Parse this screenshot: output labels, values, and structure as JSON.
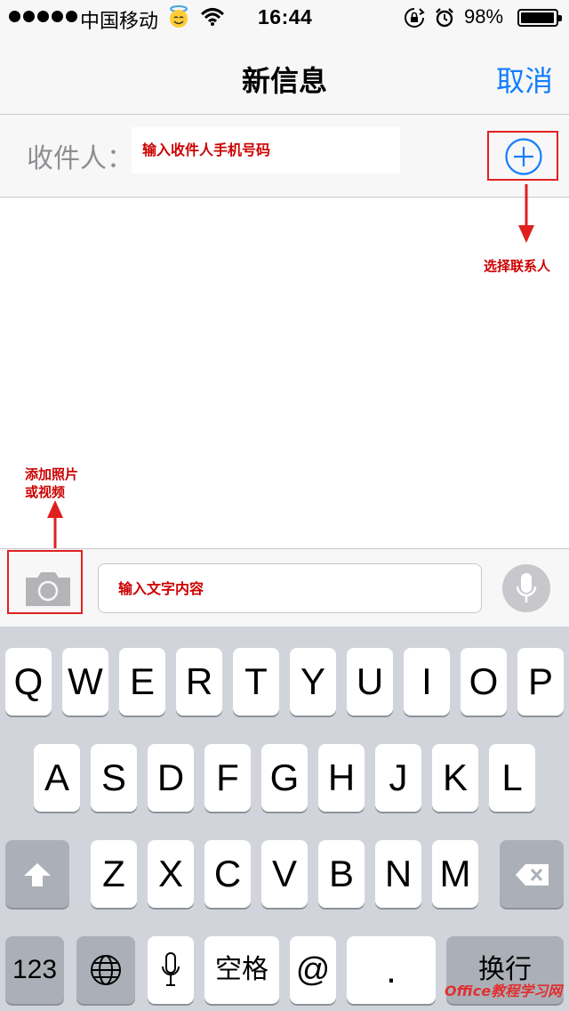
{
  "status_bar": {
    "carrier": "中国移动",
    "time": "16:44",
    "battery": "98%"
  },
  "nav": {
    "title": "新信息",
    "cancel": "取消"
  },
  "recipient": {
    "label": "收件人：",
    "placeholder": "输入收件人手机号码"
  },
  "annotations": {
    "contact": "选择联系人",
    "photo_line1": "添加照片",
    "photo_line2": "或视频",
    "text": "输入文字内容"
  },
  "keyboard": {
    "row1": [
      "Q",
      "W",
      "E",
      "R",
      "T",
      "Y",
      "U",
      "I",
      "O",
      "P"
    ],
    "row2": [
      "A",
      "S",
      "D",
      "F",
      "G",
      "H",
      "J",
      "K",
      "L"
    ],
    "row3": [
      "Z",
      "X",
      "C",
      "V",
      "B",
      "N",
      "M"
    ],
    "num": "123",
    "space": "空格",
    "at": "@",
    "dot": ".",
    "return": "换行"
  },
  "watermark": "Office教程学习网",
  "colors": {
    "accent": "#147efb",
    "annotation": "#cc0000",
    "highlight_box": "#e02020"
  }
}
